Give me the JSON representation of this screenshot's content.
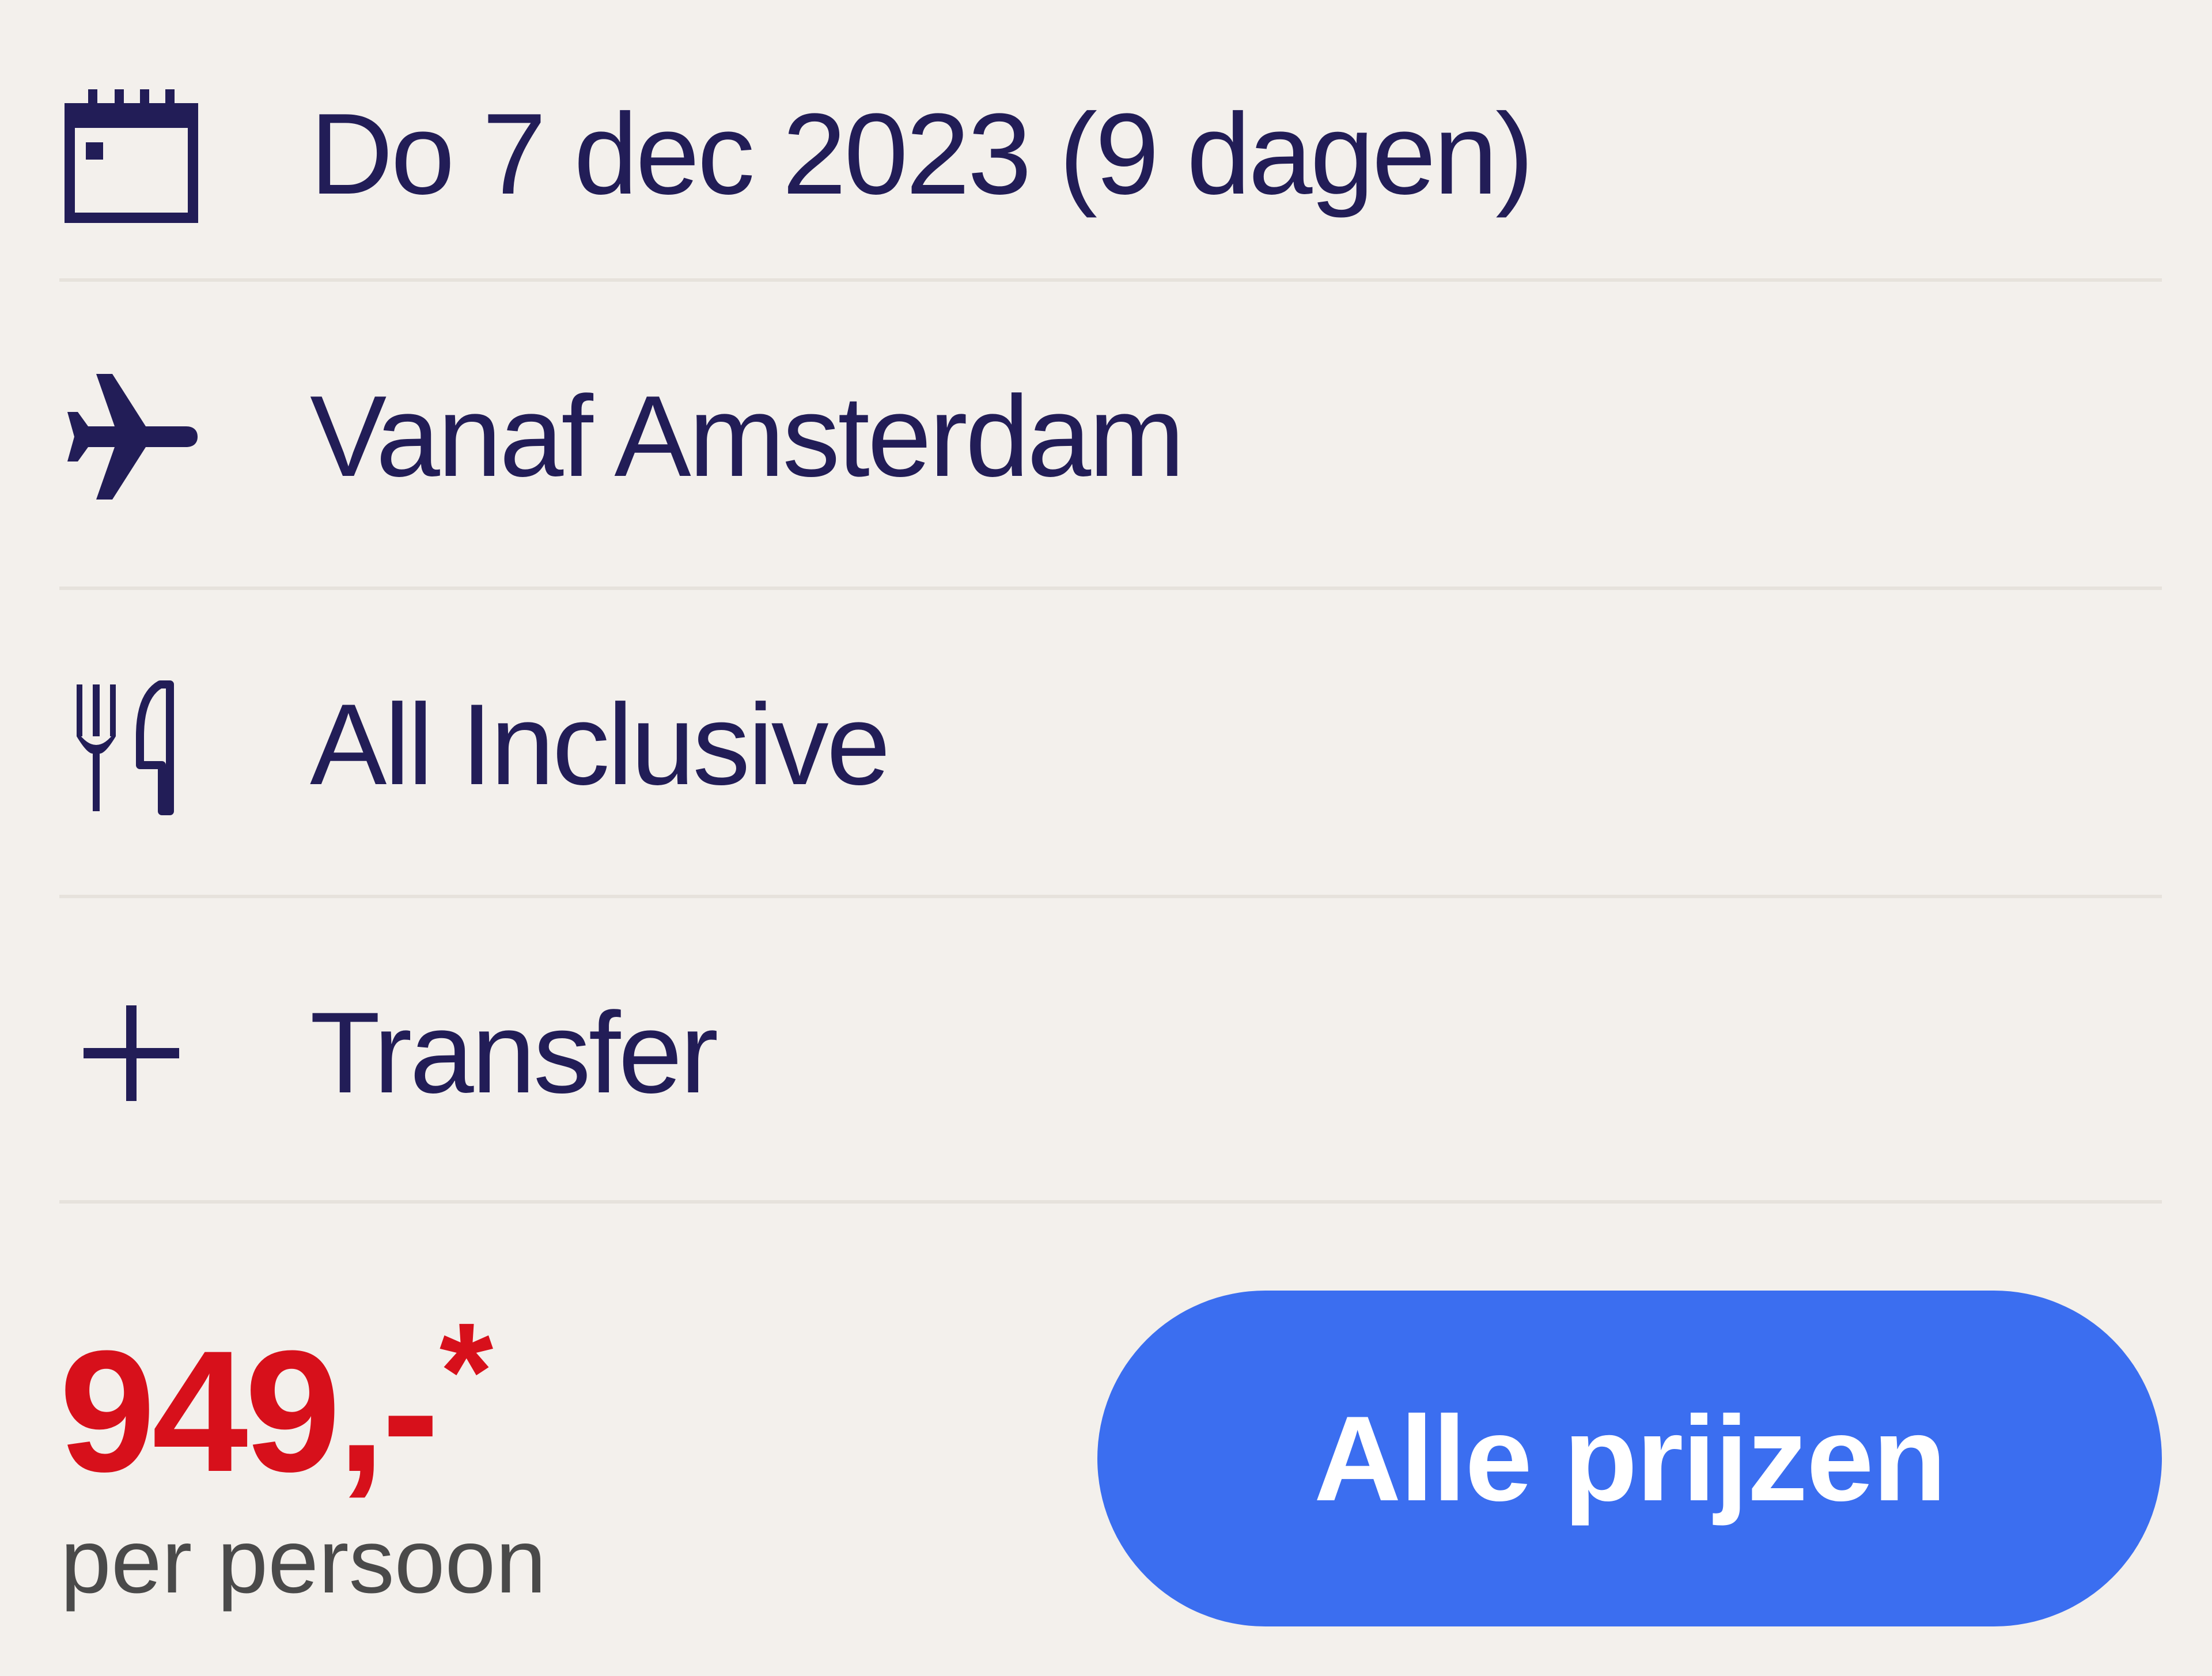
{
  "details": {
    "date": {
      "icon": "calendar-icon",
      "label": "Do 7 dec 2023 (9 dagen)"
    },
    "departure": {
      "icon": "airplane-icon",
      "label": "Vanaf Amsterdam"
    },
    "board": {
      "icon": "cutlery-icon",
      "label": "All Inclusive"
    },
    "extra": {
      "icon": "plus-icon",
      "label": "Transfer"
    }
  },
  "price": {
    "amount": "949,-",
    "asterisk": "*",
    "unit": "per persoon"
  },
  "cta": {
    "label": "Alle prijzen"
  },
  "colors": {
    "background": "#f3f0ec",
    "text": "#221d57",
    "price": "#d7101b",
    "button": "#3b6ef0",
    "divider": "#e6e2dc"
  }
}
